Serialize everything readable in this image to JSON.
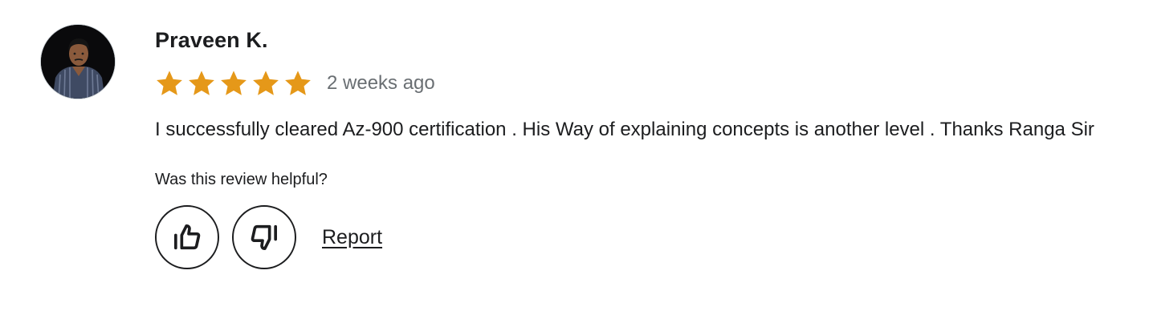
{
  "review": {
    "reviewer_name": "Praveen K.",
    "rating": 5,
    "rating_max": 5,
    "star_color": "#e59819",
    "date_text": "2 weeks ago",
    "text": "I successfully cleared Az-900 certification . His Way of explaining concepts is another level . Thanks Ranga Sir",
    "helpful_prompt": "Was this review helpful?",
    "report_label": "Report",
    "icons": {
      "avatar": "avatar-photo",
      "thumbs_up": "thumbs-up-icon",
      "thumbs_down": "thumbs-down-icon",
      "star": "star-icon"
    }
  }
}
